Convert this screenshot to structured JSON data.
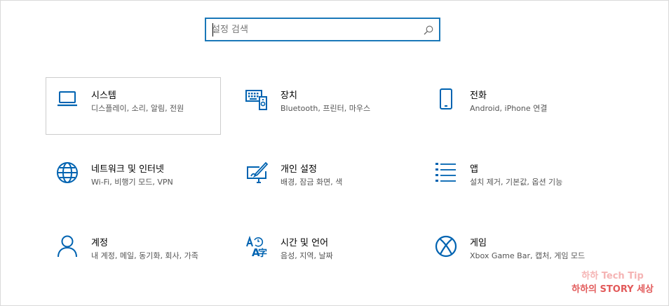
{
  "search": {
    "placeholder": "설정 검색",
    "icon": "search-icon"
  },
  "tiles": [
    {
      "title": "시스템",
      "desc": "디스플레이, 소리, 알림, 전원",
      "icon": "laptop-icon"
    },
    {
      "title": "장치",
      "desc": "Bluetooth, 프린터, 마우스",
      "icon": "keyboard-device-icon"
    },
    {
      "title": "전화",
      "desc": "Android, iPhone 연결",
      "icon": "phone-icon"
    },
    {
      "title": "네트워크 및 인터넷",
      "desc": "Wi-Fi, 비행기 모드, VPN",
      "icon": "globe-icon"
    },
    {
      "title": "개인 설정",
      "desc": "배경, 잠금 화면, 색",
      "icon": "paint-brush-icon"
    },
    {
      "title": "앱",
      "desc": "설치 제거, 기본값, 옵션 기능",
      "icon": "app-list-icon"
    },
    {
      "title": "계정",
      "desc": "내 계정, 메일, 동기화, 회사, 가족",
      "icon": "person-icon"
    },
    {
      "title": "시간 및 언어",
      "desc": "음성, 지역, 날짜",
      "icon": "time-language-icon"
    },
    {
      "title": "게임",
      "desc": "Xbox Game Bar, 캡처, 게임 모드",
      "icon": "xbox-icon"
    }
  ],
  "watermark": {
    "line1": "하하 Tech Tip",
    "line2": "하하의 STORY 세상"
  },
  "colors": {
    "accent": "#0063b1",
    "search_border": "#1a78b8"
  }
}
